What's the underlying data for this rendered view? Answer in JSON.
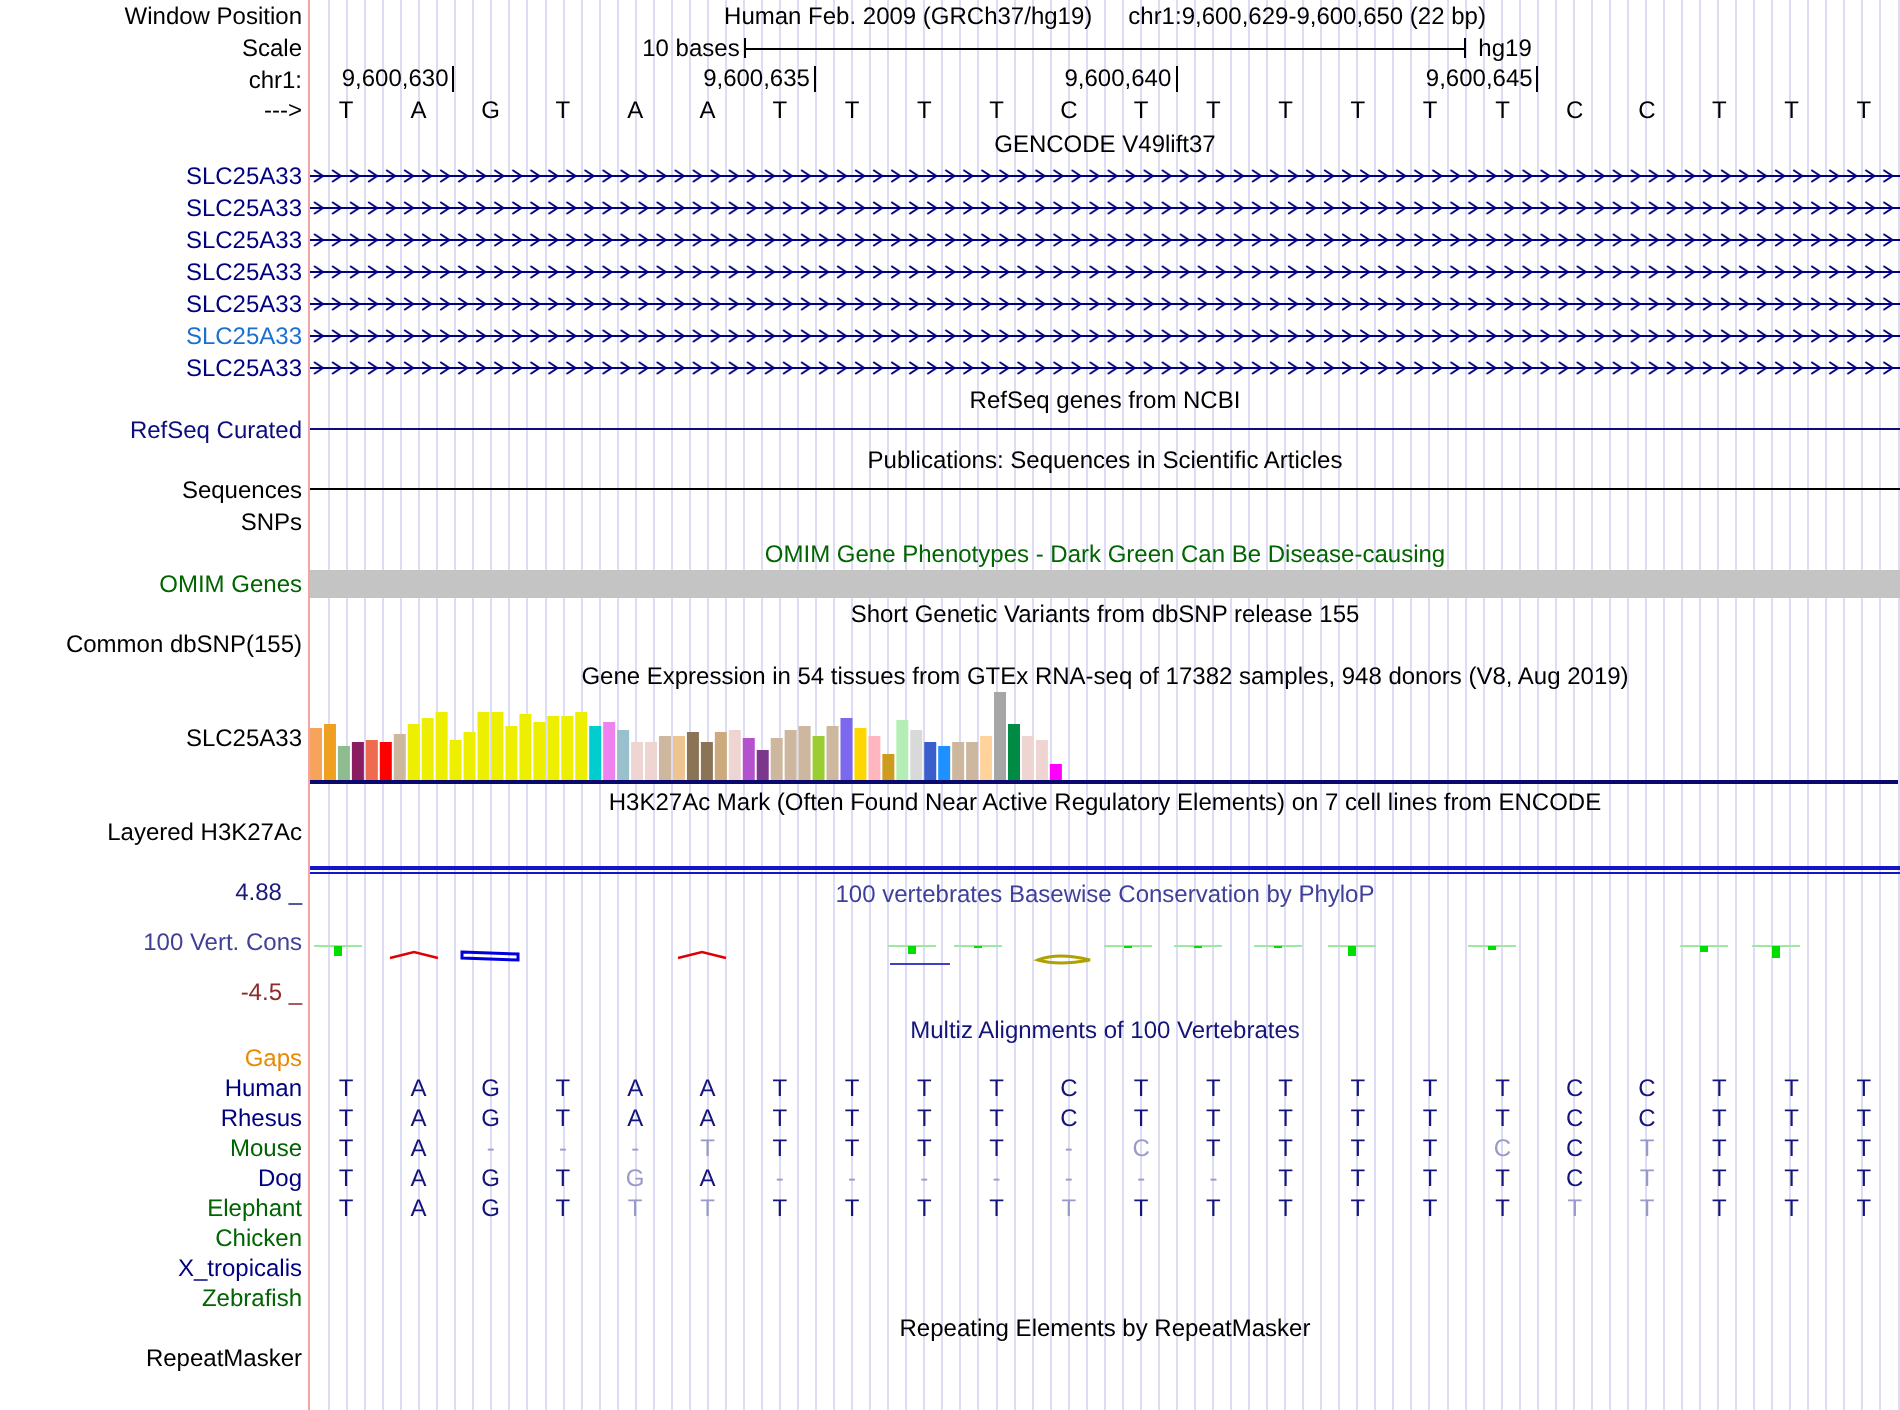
{
  "header": {
    "window_position_label": "Window Position",
    "assembly": "Human Feb. 2009 (GRCh37/hg19)",
    "position": "chr1:9,600,629-9,600,650 (22 bp)",
    "scale_label": "Scale",
    "scale_text": "10 bases",
    "scale_assembly": "hg19",
    "chrom_label": "chr1:",
    "ticks": [
      "9,600,630",
      "9,600,635",
      "9,600,640",
      "9,600,645"
    ],
    "strand_label": "--->",
    "bases": [
      "T",
      "A",
      "G",
      "T",
      "A",
      "A",
      "T",
      "T",
      "T",
      "T",
      "C",
      "T",
      "T",
      "T",
      "T",
      "T",
      "T",
      "C",
      "C",
      "T",
      "T",
      "T"
    ]
  },
  "tracks": [
    {
      "kind": "gene",
      "title": "GENCODE V49lift37",
      "items": [
        {
          "label": "SLC25A33",
          "color": "#000080"
        },
        {
          "label": "SLC25A33",
          "color": "#000080"
        },
        {
          "label": "SLC25A33",
          "color": "#000080"
        },
        {
          "label": "SLC25A33",
          "color": "#000080"
        },
        {
          "label": "SLC25A33",
          "color": "#000080"
        },
        {
          "label": "SLC25A33",
          "color": "#1c6fd0"
        },
        {
          "label": "SLC25A33",
          "color": "#000080"
        }
      ]
    },
    {
      "kind": "line",
      "title": "RefSeq genes from NCBI",
      "label": "RefSeq Curated",
      "color": "#0c0c7c"
    },
    {
      "kind": "line",
      "title": "Publications: Sequences in Scientific Articles",
      "label": "Sequences",
      "color": "#000000"
    },
    {
      "kind": "empty",
      "label": "SNPs",
      "color": "#000000"
    },
    {
      "kind": "band",
      "title": "OMIM Gene Phenotypes - Dark Green Can Be Disease-causing",
      "label": "OMIM Genes",
      "color": "#006400"
    },
    {
      "kind": "empty",
      "title": "Short Genetic Variants from dbSNP release 155",
      "label": "Common dbSNP(155)",
      "color": "#000000"
    },
    {
      "kind": "expression",
      "title": "Gene Expression in 54 tissues from GTEx RNA-seq of 17382 samples, 948 donors (V8, Aug 2019)",
      "label": "SLC25A33",
      "color": "#000000"
    },
    {
      "kind": "signal",
      "title": "H3K27Ac Mark (Often Found Near Active Regulatory Elements) on 7 cell lines from ENCODE",
      "label": "Layered H3K27Ac",
      "color": "#000000"
    },
    {
      "kind": "conservation",
      "title": "100 vertebrates Basewise Conservation by PhyloP",
      "label": "100 Vert. Cons",
      "color": "#40409a",
      "y_max": "4.88 _",
      "y_min": "-4.5 _"
    },
    {
      "kind": "alignment",
      "title": "Multiz Alignments of 100 Vertebrates",
      "color": "#14147a",
      "gaps_label": "Gaps",
      "species": [
        {
          "label": "Human",
          "color": "#000080",
          "bases": [
            {
              "base": "T",
              "faded": false
            },
            {
              "base": "A",
              "faded": false
            },
            {
              "base": "G",
              "faded": false
            },
            {
              "base": "T",
              "faded": false
            },
            {
              "base": "A",
              "faded": false
            },
            {
              "base": "A",
              "faded": false
            },
            {
              "base": "T",
              "faded": false
            },
            {
              "base": "T",
              "faded": false
            },
            {
              "base": "T",
              "faded": false
            },
            {
              "base": "T",
              "faded": false
            },
            {
              "base": "C",
              "faded": false
            },
            {
              "base": "T",
              "faded": false
            },
            {
              "base": "T",
              "faded": false
            },
            {
              "base": "T",
              "faded": false
            },
            {
              "base": "T",
              "faded": false
            },
            {
              "base": "T",
              "faded": false
            },
            {
              "base": "T",
              "faded": false
            },
            {
              "base": "C",
              "faded": false
            },
            {
              "base": "C",
              "faded": false
            },
            {
              "base": "T",
              "faded": false
            },
            {
              "base": "T",
              "faded": false
            },
            {
              "base": "T",
              "faded": false
            }
          ]
        },
        {
          "label": "Rhesus",
          "color": "#000080",
          "bases": [
            {
              "base": "T",
              "faded": false
            },
            {
              "base": "A",
              "faded": false
            },
            {
              "base": "G",
              "faded": false
            },
            {
              "base": "T",
              "faded": false
            },
            {
              "base": "A",
              "faded": false
            },
            {
              "base": "A",
              "faded": false
            },
            {
              "base": "T",
              "faded": false
            },
            {
              "base": "T",
              "faded": false
            },
            {
              "base": "T",
              "faded": false
            },
            {
              "base": "T",
              "faded": false
            },
            {
              "base": "C",
              "faded": false
            },
            {
              "base": "T",
              "faded": false
            },
            {
              "base": "T",
              "faded": false
            },
            {
              "base": "T",
              "faded": false
            },
            {
              "base": "T",
              "faded": false
            },
            {
              "base": "T",
              "faded": false
            },
            {
              "base": "T",
              "faded": false
            },
            {
              "base": "C",
              "faded": false
            },
            {
              "base": "C",
              "faded": false
            },
            {
              "base": "T",
              "faded": false
            },
            {
              "base": "T",
              "faded": false
            },
            {
              "base": "T",
              "faded": false
            }
          ]
        },
        {
          "label": "Mouse",
          "color": "#006400",
          "bases": [
            {
              "base": "T",
              "faded": false
            },
            {
              "base": "A",
              "faded": false
            },
            {
              "base": "-",
              "faded": true
            },
            {
              "base": "-",
              "faded": true
            },
            {
              "base": "-",
              "faded": true
            },
            {
              "base": "T",
              "faded": true
            },
            {
              "base": "T",
              "faded": false
            },
            {
              "base": "T",
              "faded": false
            },
            {
              "base": "T",
              "faded": false
            },
            {
              "base": "T",
              "faded": false
            },
            {
              "base": "-",
              "faded": true
            },
            {
              "base": "C",
              "faded": true
            },
            {
              "base": "T",
              "faded": false
            },
            {
              "base": "T",
              "faded": false
            },
            {
              "base": "T",
              "faded": false
            },
            {
              "base": "T",
              "faded": false
            },
            {
              "base": "C",
              "faded": true
            },
            {
              "base": "C",
              "faded": false
            },
            {
              "base": "T",
              "faded": true
            },
            {
              "base": "T",
              "faded": false
            },
            {
              "base": "T",
              "faded": false
            },
            {
              "base": "T",
              "faded": false
            }
          ]
        },
        {
          "label": "Dog",
          "color": "#000080",
          "bases": [
            {
              "base": "T",
              "faded": false
            },
            {
              "base": "A",
              "faded": false
            },
            {
              "base": "G",
              "faded": false
            },
            {
              "base": "T",
              "faded": false
            },
            {
              "base": "G",
              "faded": true
            },
            {
              "base": "A",
              "faded": false
            },
            {
              "base": "-",
              "faded": true
            },
            {
              "base": "-",
              "faded": true
            },
            {
              "base": "-",
              "faded": true
            },
            {
              "base": "-",
              "faded": true
            },
            {
              "base": "-",
              "faded": true
            },
            {
              "base": "-",
              "faded": true
            },
            {
              "base": "-",
              "faded": true
            },
            {
              "base": "T",
              "faded": false
            },
            {
              "base": "T",
              "faded": false
            },
            {
              "base": "T",
              "faded": false
            },
            {
              "base": "T",
              "faded": false
            },
            {
              "base": "C",
              "faded": false
            },
            {
              "base": "T",
              "faded": true
            },
            {
              "base": "T",
              "faded": false
            },
            {
              "base": "T",
              "faded": false
            },
            {
              "base": "T",
              "faded": false
            }
          ]
        },
        {
          "label": "Elephant",
          "color": "#006400",
          "bases": [
            {
              "base": "T",
              "faded": false
            },
            {
              "base": "A",
              "faded": false
            },
            {
              "base": "G",
              "faded": false
            },
            {
              "base": "T",
              "faded": false
            },
            {
              "base": "T",
              "faded": true
            },
            {
              "base": "T",
              "faded": true
            },
            {
              "base": "T",
              "faded": false
            },
            {
              "base": "T",
              "faded": false
            },
            {
              "base": "T",
              "faded": false
            },
            {
              "base": "T",
              "faded": false
            },
            {
              "base": "T",
              "faded": true
            },
            {
              "base": "T",
              "faded": false
            },
            {
              "base": "T",
              "faded": false
            },
            {
              "base": "T",
              "faded": false
            },
            {
              "base": "T",
              "faded": false
            },
            {
              "base": "T",
              "faded": false
            },
            {
              "base": "T",
              "faded": false
            },
            {
              "base": "T",
              "faded": true
            },
            {
              "base": "T",
              "faded": true
            },
            {
              "base": "T",
              "faded": false
            },
            {
              "base": "T",
              "faded": false
            },
            {
              "base": "T",
              "faded": false
            }
          ]
        },
        {
          "label": "Chicken",
          "color": "#006400"
        },
        {
          "label": "X_tropicalis",
          "color": "#000080"
        },
        {
          "label": "Zebrafish",
          "color": "#006400"
        }
      ]
    },
    {
      "kind": "empty",
      "title": "Repeating Elements by RepeatMasker",
      "label": "RepeatMasker",
      "color": "#000000"
    }
  ]
}
